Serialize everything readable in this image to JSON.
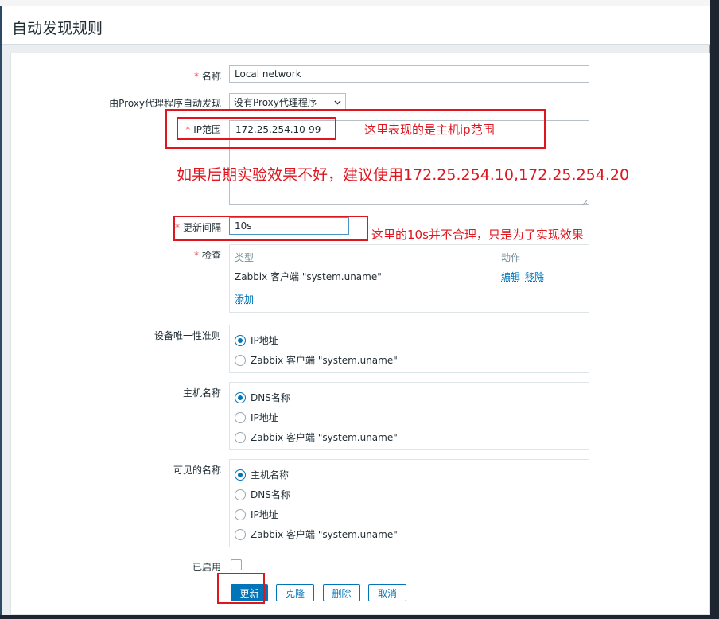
{
  "page": {
    "title": "自动发现规则"
  },
  "form": {
    "name": {
      "label": "名称",
      "value": "Local network"
    },
    "proxy": {
      "label": "由Proxy代理程序自动发现",
      "value": "没有Proxy代理程序"
    },
    "ip_range": {
      "label": "IP范围",
      "value": "172.25.254.10-99"
    },
    "interval": {
      "label": "更新间隔",
      "value": "10s"
    },
    "checks": {
      "label": "检查",
      "col_type": "类型",
      "col_action": "动作",
      "rows": [
        {
          "type": "Zabbix 客户端 \"system.uname\"",
          "edit": "编辑",
          "remove": "移除"
        }
      ],
      "add": "添加"
    },
    "uniqueness": {
      "label": "设备唯一性准则",
      "options": [
        "IP地址",
        "Zabbix 客户端 \"system.uname\""
      ],
      "selected": 0
    },
    "host_name": {
      "label": "主机名称",
      "options": [
        "DNS名称",
        "IP地址",
        "Zabbix 客户端 \"system.uname\""
      ],
      "selected": 0
    },
    "visible_name": {
      "label": "可见的名称",
      "options": [
        "主机名称",
        "DNS名称",
        "IP地址",
        "Zabbix 客户端 \"system.uname\""
      ],
      "selected": 0
    },
    "enabled": {
      "label": "已启用"
    },
    "buttons": {
      "update": "更新",
      "clone": "克隆",
      "delete": "删除",
      "cancel": "取消"
    }
  },
  "annotations": {
    "ip_note": "这里表现的是主机ip范围",
    "suggest_note": "如果后期实验效果不好，建议使用172.25.254.10,172.25.254.20",
    "interval_note": "这里的10s并不合理，只是为了实现效果"
  },
  "colors": {
    "accent": "#0275b8",
    "annotation": "#e0161f",
    "required": "#e45959"
  }
}
